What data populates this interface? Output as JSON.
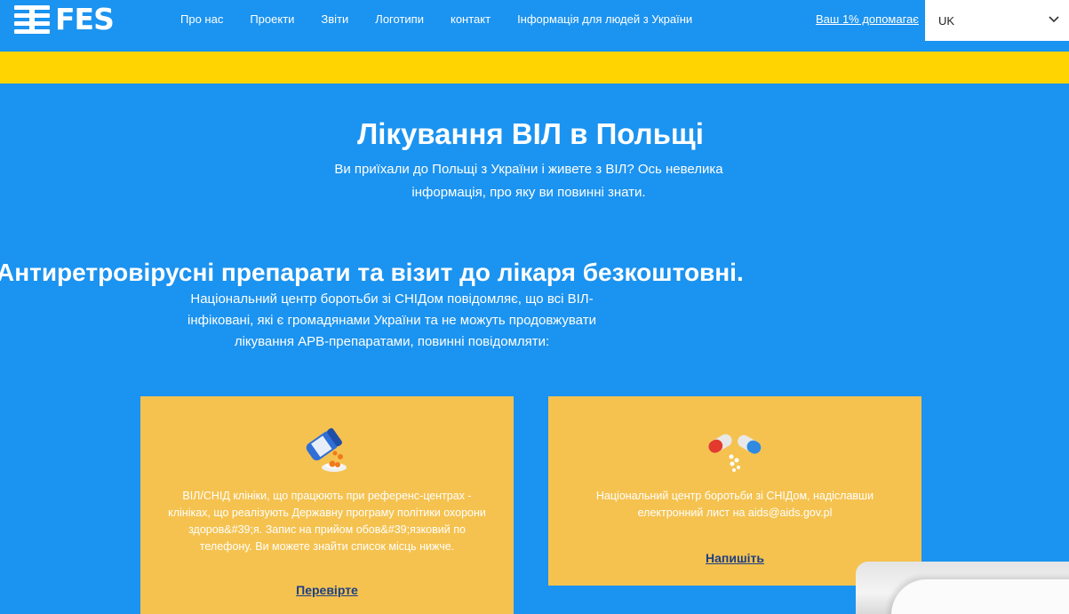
{
  "header": {
    "logo_text": "FES",
    "nav": [
      "Про нас",
      "Проекти",
      "Звіти",
      "Логотипи",
      "контакт",
      "Інформація для людей з України"
    ],
    "support_text": "Ваш 1% допомагає",
    "language": {
      "selected": "UK"
    }
  },
  "colors": {
    "background": "#1b93f0",
    "band": "#ffd400",
    "card": "#f5c24f",
    "link": "#1d3f82"
  },
  "hero": {
    "title": "Лікування ВІЛ в Польщі",
    "subtitle": "Ви приїхали до Польщі з України і живете з ВІЛ? Ось невелика інформація, про яку ви повинні знати."
  },
  "section": {
    "title": "Антиретровірусні препарати та візит до лікаря безкоштовні.",
    "text": "Національний центр боротьби зі СНІДом повідомляє, що всі ВІЛ-інфіковані, які є громадянами України та не можуть продовжувати лікування АРВ-препаратами, повинні повідомляти:"
  },
  "cards": [
    {
      "icon": "pill-bottle-icon",
      "text": "ВІЛ/СНІД клініки, що працюють при референс-центрах - клініках, що реалізують Державну програму політики охорони здоров&#39;я. Запис на прийом обов&#39;язковий по телефону. Ви можете знайти список місць нижче.",
      "link": "Перевірте"
    },
    {
      "icon": "capsules-icon",
      "text": "Національний центр боротьби зі СНІДом, надіславши електронний лист на aids@aids.gov.pl",
      "link": "Напишіть"
    }
  ]
}
